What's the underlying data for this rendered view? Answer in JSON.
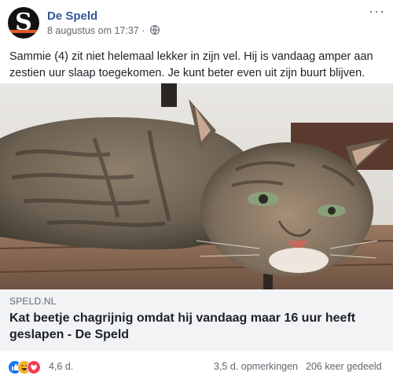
{
  "post": {
    "page_name": "De Speld",
    "avatar_letter": "S",
    "timestamp": "8 augustus om 17:37 ·",
    "privacy_icon": "globe-icon",
    "more_label": "···",
    "text": "Sammie (4) zit niet helemaal lekker in zijn vel. Hij is vandaag amper aan zestien uur slaap toegekomen. Je kunt beter even uit zijn buurt blijven."
  },
  "link": {
    "domain": "SPELD.NL",
    "headline": "Kat beetje chagrijnig omdat hij vandaag maar 16 uur heeft geslapen - De Speld"
  },
  "stats": {
    "reactions": "4,6 d.",
    "comments": "3,5 d. opmerkingen",
    "shares": "206 keer gedeeld",
    "reaction_icons": [
      "like-icon",
      "haha-icon",
      "love-icon"
    ]
  },
  "colors": {
    "page_name": "#365899",
    "link_card_bg": "#f2f3f5",
    "like": "#1877f2",
    "haha": "#f7b125",
    "love": "#f33e58"
  }
}
